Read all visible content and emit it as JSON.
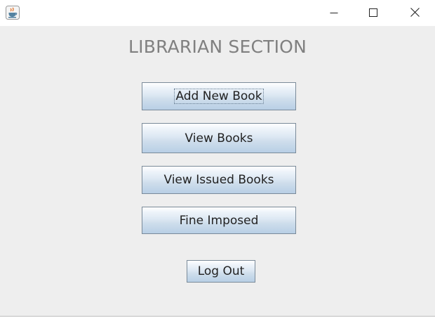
{
  "window": {
    "icon": "java-cup-icon",
    "controls": {
      "minimize_icon": "minimize-icon",
      "maximize_icon": "maximize-icon",
      "close_icon": "close-icon"
    }
  },
  "page": {
    "title": "LIBRARIAN SECTION"
  },
  "buttons": {
    "add_new_book": "Add New Book",
    "view_books": "View Books",
    "view_issued_books": "View Issued Books",
    "fine_imposed": "Fine Imposed",
    "log_out": "Log Out"
  },
  "colors": {
    "title_text": "#808080",
    "background": "#eeeeee",
    "titlebar": "#ffffff",
    "button_border": "#7a8a99"
  }
}
